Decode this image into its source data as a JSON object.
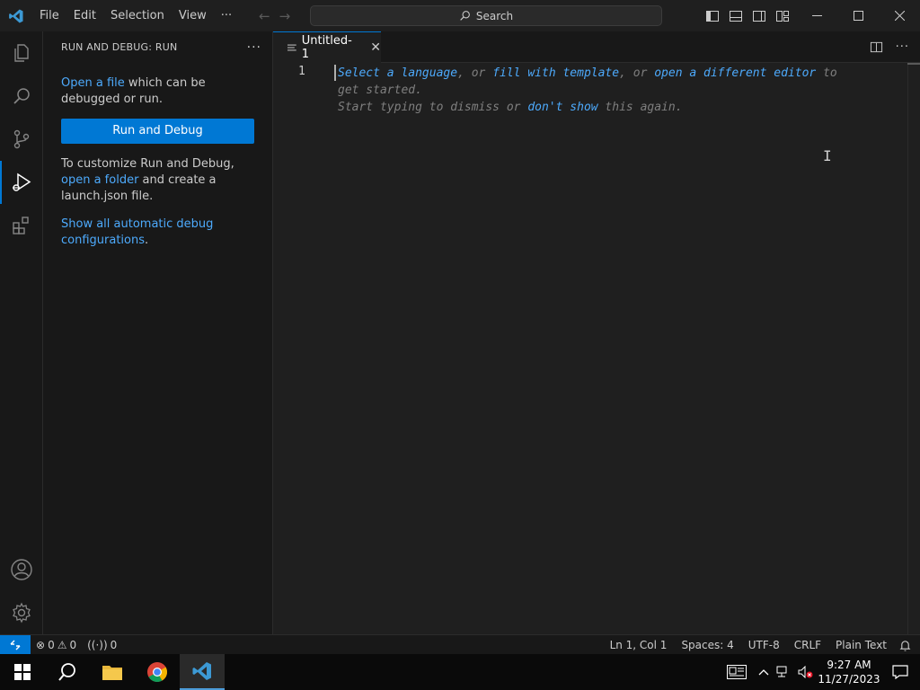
{
  "menu": {
    "file": "File",
    "edit": "Edit",
    "selection": "Selection",
    "view": "View",
    "more": "···"
  },
  "search": {
    "label": "Search"
  },
  "sidebar": {
    "title": "RUN AND DEBUG: RUN",
    "more": "···",
    "open_file_link": "Open a file",
    "open_file_rest": " which can be debugged or run.",
    "run_button": "Run and Debug",
    "customize_prefix": "To customize Run and Debug, ",
    "open_folder_link": "open a folder",
    "customize_suffix": " and create a launch.json file.",
    "show_all_link": "Show all automatic debug configurations",
    "show_all_period": "."
  },
  "editor": {
    "tab_label": "Untitled-1",
    "line_number": "1",
    "hint": {
      "select_language": "Select a language",
      "sep1": ", or ",
      "fill_template": "fill with template",
      "sep2": ", or ",
      "open_editor": "open a different editor",
      "to_get_started": " to get started.",
      "start_typing": "Start typing to dismiss or ",
      "dont_show": "don't show",
      "this_again": " this again."
    }
  },
  "statusbar": {
    "errors": "0",
    "warnings": "0",
    "ports": "0",
    "position": "Ln 1, Col 1",
    "spaces": "Spaces: 4",
    "encoding": "UTF-8",
    "eol": "CRLF",
    "language": "Plain Text"
  },
  "taskbar": {
    "time": "9:27 AM",
    "date": "11/27/2023"
  },
  "colors": {
    "accent": "#0078d4",
    "link": "#4daafc"
  }
}
